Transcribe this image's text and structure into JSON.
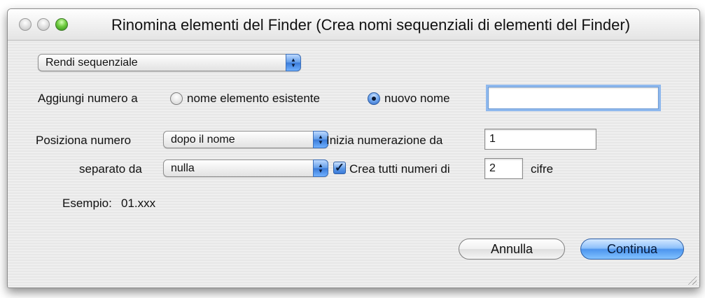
{
  "window": {
    "title": "Rinomina elementi del Finder (Crea nomi sequenziali di elementi del Finder)",
    "controls": [
      "close-button",
      "minimize-button",
      "zoom-button"
    ]
  },
  "mode_popup": {
    "value": "Rendi sequenziale"
  },
  "add_number": {
    "label": "Aggiungi numero a",
    "option_existing": "nome elemento esistente",
    "option_new": "nuovo nome",
    "selected": "nuovo nome",
    "new_name_value": ""
  },
  "position": {
    "label": "Posiziona numero",
    "value": "dopo il nome"
  },
  "start": {
    "label": "Inizia numerazione  da",
    "value": "1"
  },
  "separator": {
    "label": "separato da",
    "value": "nulla"
  },
  "digits": {
    "label": "Crea tutti numeri di",
    "checked": true,
    "value": "2",
    "suffix": "cifre"
  },
  "example": {
    "label": "Esempio:",
    "value": "01.xxx"
  },
  "buttons": {
    "cancel": "Annulla",
    "continue": "Continua"
  },
  "colors": {
    "accent": "#5f9be8",
    "default_button": "#4d95ee",
    "zoom_light": "#6fcc3f"
  }
}
